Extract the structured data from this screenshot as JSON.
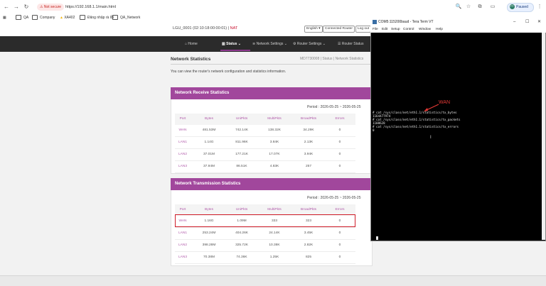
{
  "browser": {
    "security_label": "Not secure",
    "url": "https://192.168.1.1/main.html",
    "profile_initial": "PT",
    "profile_status": "Paused",
    "bookmarks": [
      "QA",
      "Company",
      "XA402",
      "Đăng nhập rà lỗi",
      "QA_Network"
    ]
  },
  "router": {
    "model_line": "LGU_0001 (02:10:18:00:00:01) |",
    "model_nat": "NAT",
    "language": "English",
    "connected_label": "Connected Router",
    "logout_label": "Log out",
    "menu": [
      "Home",
      "Status",
      "Network Settings",
      "Router Settings",
      "Router Status"
    ],
    "page_title": "Network Statistics",
    "breadcrumb": "MD7730008 | Status | Network Statistics",
    "description": "You can view the router's network configuration and statistics information."
  },
  "receive": {
    "title": "Network Receive Statistics",
    "period_label": "Period : 2026-05-25 ~ 2026-05-25",
    "columns": [
      "Port",
      "Bytes",
      "UniPkts",
      "MultiPkts",
      "BroadPkts",
      "Errors"
    ],
    "rows": [
      [
        "WAN",
        "481.53M",
        "742.14K",
        "138.32K",
        "34.29K",
        "0"
      ],
      [
        "LAN1",
        "1.14G",
        "811.96K",
        "3.84K",
        "2.13K",
        "0"
      ],
      [
        "LAN2",
        "37.01M",
        "177.21K",
        "17.07K",
        "3.94K",
        "0"
      ],
      [
        "LAN3",
        "37.94M",
        "86.51K",
        "4.83K",
        "257",
        "0"
      ]
    ]
  },
  "transmission": {
    "title": "Network Transmission Statistics",
    "period_label": "Period : 2026-05-25 ~ 2026-05-25",
    "columns": [
      "Port",
      "Bytes",
      "UniPkts",
      "MultiPkts",
      "BroadPkts",
      "Errors"
    ],
    "rows": [
      [
        "WAN",
        "1.16G",
        "1.09M",
        "333",
        "323",
        "0"
      ],
      [
        "LAN1",
        "253.24M",
        "404.26K",
        "24.14K",
        "3.45K",
        "0"
      ],
      [
        "LAN2",
        "398.28M",
        "325.72K",
        "10.38K",
        "2.82K",
        "0"
      ],
      [
        "LAN3",
        "70.38M",
        "74.36K",
        "1.25K",
        "825",
        "0"
      ]
    ]
  },
  "terminal": {
    "title": "COM5:115200baud - Tera Term VT",
    "menu": [
      "File",
      "Edit",
      "Setup",
      "Control",
      "Window",
      "Help"
    ],
    "annotation": "WAN",
    "lines": [
      "# cat /sys/class/net/eth1.1/statistics/tx_bytes",
      "1164477974",
      "# cat /sys/class/net/eth1.1/statistics/tx_packets",
      "1108628",
      "# cat /sys/class/net/eth1.1/statistics/tx_errors",
      "0"
    ]
  },
  "colors": {
    "accent": "#a1479c",
    "highlight": "#d01d2a",
    "menu_bg": "#2b2b2b"
  }
}
